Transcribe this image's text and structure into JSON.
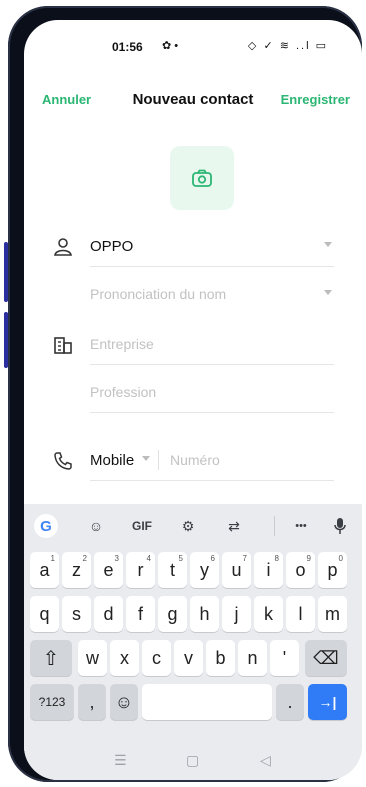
{
  "status_bar": {
    "time": "01:56",
    "left_icons": "✿ •",
    "right_icons": "◇ ✓ ≋ ..l ▭"
  },
  "header": {
    "cancel": "Annuler",
    "title": "Nouveau contact",
    "save": "Enregistrer"
  },
  "form": {
    "name_value": "OPPO",
    "pronunciation_placeholder": "Prononciation du nom",
    "company_placeholder": "Entreprise",
    "profession_placeholder": "Profession",
    "phone_type": "Mobile",
    "phone_placeholder": "Numéro"
  },
  "keyboard": {
    "toolbar": [
      "G",
      "☺",
      "GIF",
      "⚙",
      "⇄",
      "•••",
      "🎤"
    ],
    "row1": [
      [
        "a",
        "1"
      ],
      [
        "z",
        "2"
      ],
      [
        "e",
        "3"
      ],
      [
        "r",
        "4"
      ],
      [
        "t",
        "5"
      ],
      [
        "y",
        "6"
      ],
      [
        "u",
        "7"
      ],
      [
        "i",
        "8"
      ],
      [
        "o",
        "9"
      ],
      [
        "p",
        "0"
      ]
    ],
    "row2": [
      "q",
      "s",
      "d",
      "f",
      "g",
      "h",
      "j",
      "k",
      "l",
      "m"
    ],
    "row3": [
      "w",
      "x",
      "c",
      "v",
      "b",
      "n",
      "'"
    ],
    "shift": "⇧",
    "backspace": "⌫",
    "symbols": "?123",
    "comma": ",",
    "emoji": "☺",
    "period": ".",
    "enter": "→|"
  },
  "navbar": {
    "menu": "☰",
    "home": "▢",
    "back": "◁"
  },
  "colors": {
    "accent": "#2bb673",
    "enter_key": "#2f7cf6"
  }
}
